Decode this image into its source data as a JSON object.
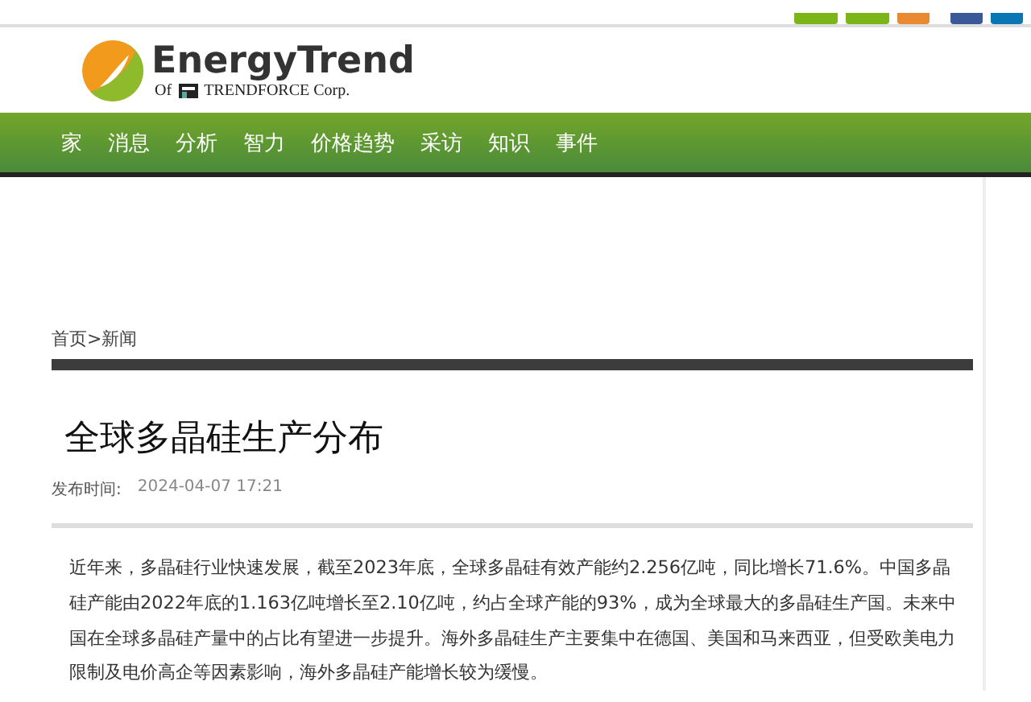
{
  "brand": {
    "name": "EnergyTrend",
    "tagline_prefix": "Of",
    "tagline_company": "TRENDFORCE Corp."
  },
  "nav": [
    {
      "label": "家"
    },
    {
      "label": "消息"
    },
    {
      "label": "分析"
    },
    {
      "label": "智力"
    },
    {
      "label": "价格趋势"
    },
    {
      "label": "采访"
    },
    {
      "label": "知识"
    },
    {
      "label": "事件"
    }
  ],
  "breadcrumb": "首页>新闻",
  "article": {
    "title": "全球多晶硅生产分布",
    "date_label": "发布时间:",
    "date": "2024-04-07 17:21",
    "body": "近年来，多晶硅行业快速发展，截至2023年底，全球多晶硅有效产能约2.256亿吨，同比增长71.6%。中国多晶硅产能由2022年底的1.163亿吨增长至2.10亿吨，约占全球产能的93%，成为全球最大的多晶硅生产国。未来中国在全球多晶硅产量中的占比有望进一步提升。海外多晶硅生产主要集中在德国、美国和马来西亚，但受欧美电力限制及电价高企等因素影响，海外多晶硅产能增长较为缓慢。"
  }
}
